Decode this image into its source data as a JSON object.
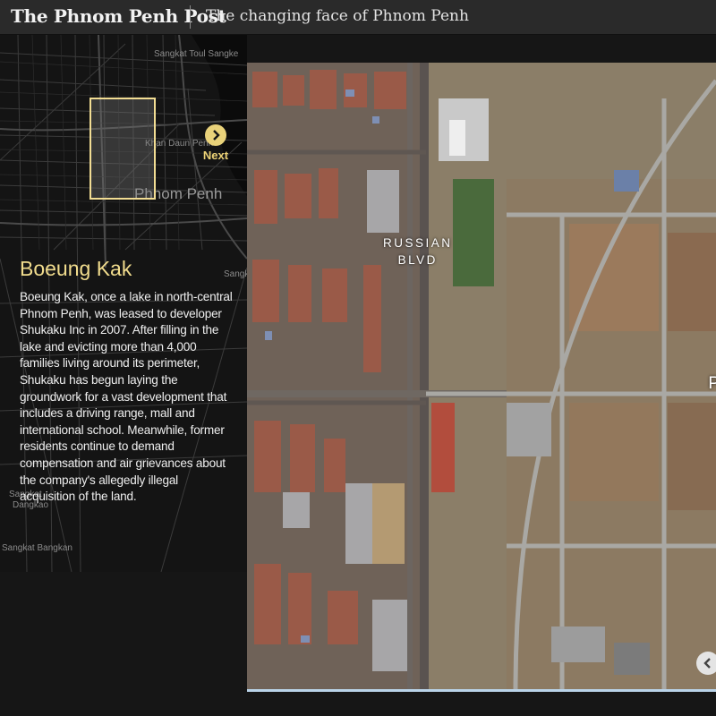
{
  "header": {
    "logo": "The Phnom Penh Post",
    "section_title": "The changing face of Phnom Penh"
  },
  "mini_map": {
    "labels": {
      "sangkat_toul_sangke": "Sangkat Toul Sangke",
      "khan_daun_penh": "Khan Daun Penh",
      "phnom_penh": "Phnom Penh",
      "sangkat_1": "Sangk",
      "sangkat_2": "Sangkat",
      "dangkao": "Dangkao",
      "sangkat_bangkan": "Sangkat Bangkan"
    },
    "next_label": "Next",
    "next_icon": "chevron-right-icon"
  },
  "story": {
    "title": "Boeung Kak",
    "body": "Boeung Kak, once a lake in north-central Phnom Penh, was leased to developer Shukaku Inc in 2007. After filling in the lake and evicting more than 4,000 families living around its perimeter, Shukaku has begun laying the groundwork for a vast development that includes a driving range, mall and international school. Meanwhile, former residents continue to demand compensation and air grievances about the company's allegedly illegal acquisition of the land."
  },
  "satellite": {
    "street_label_line1": "RUSSIAN",
    "street_label_line2": "BLVD",
    "edge_label": "P",
    "prev_icon": "chevron-left-icon"
  },
  "colors": {
    "accent_gold": "#f1dc8d",
    "header_bg": "#2a2a2a",
    "panel_bg": "#161616"
  }
}
